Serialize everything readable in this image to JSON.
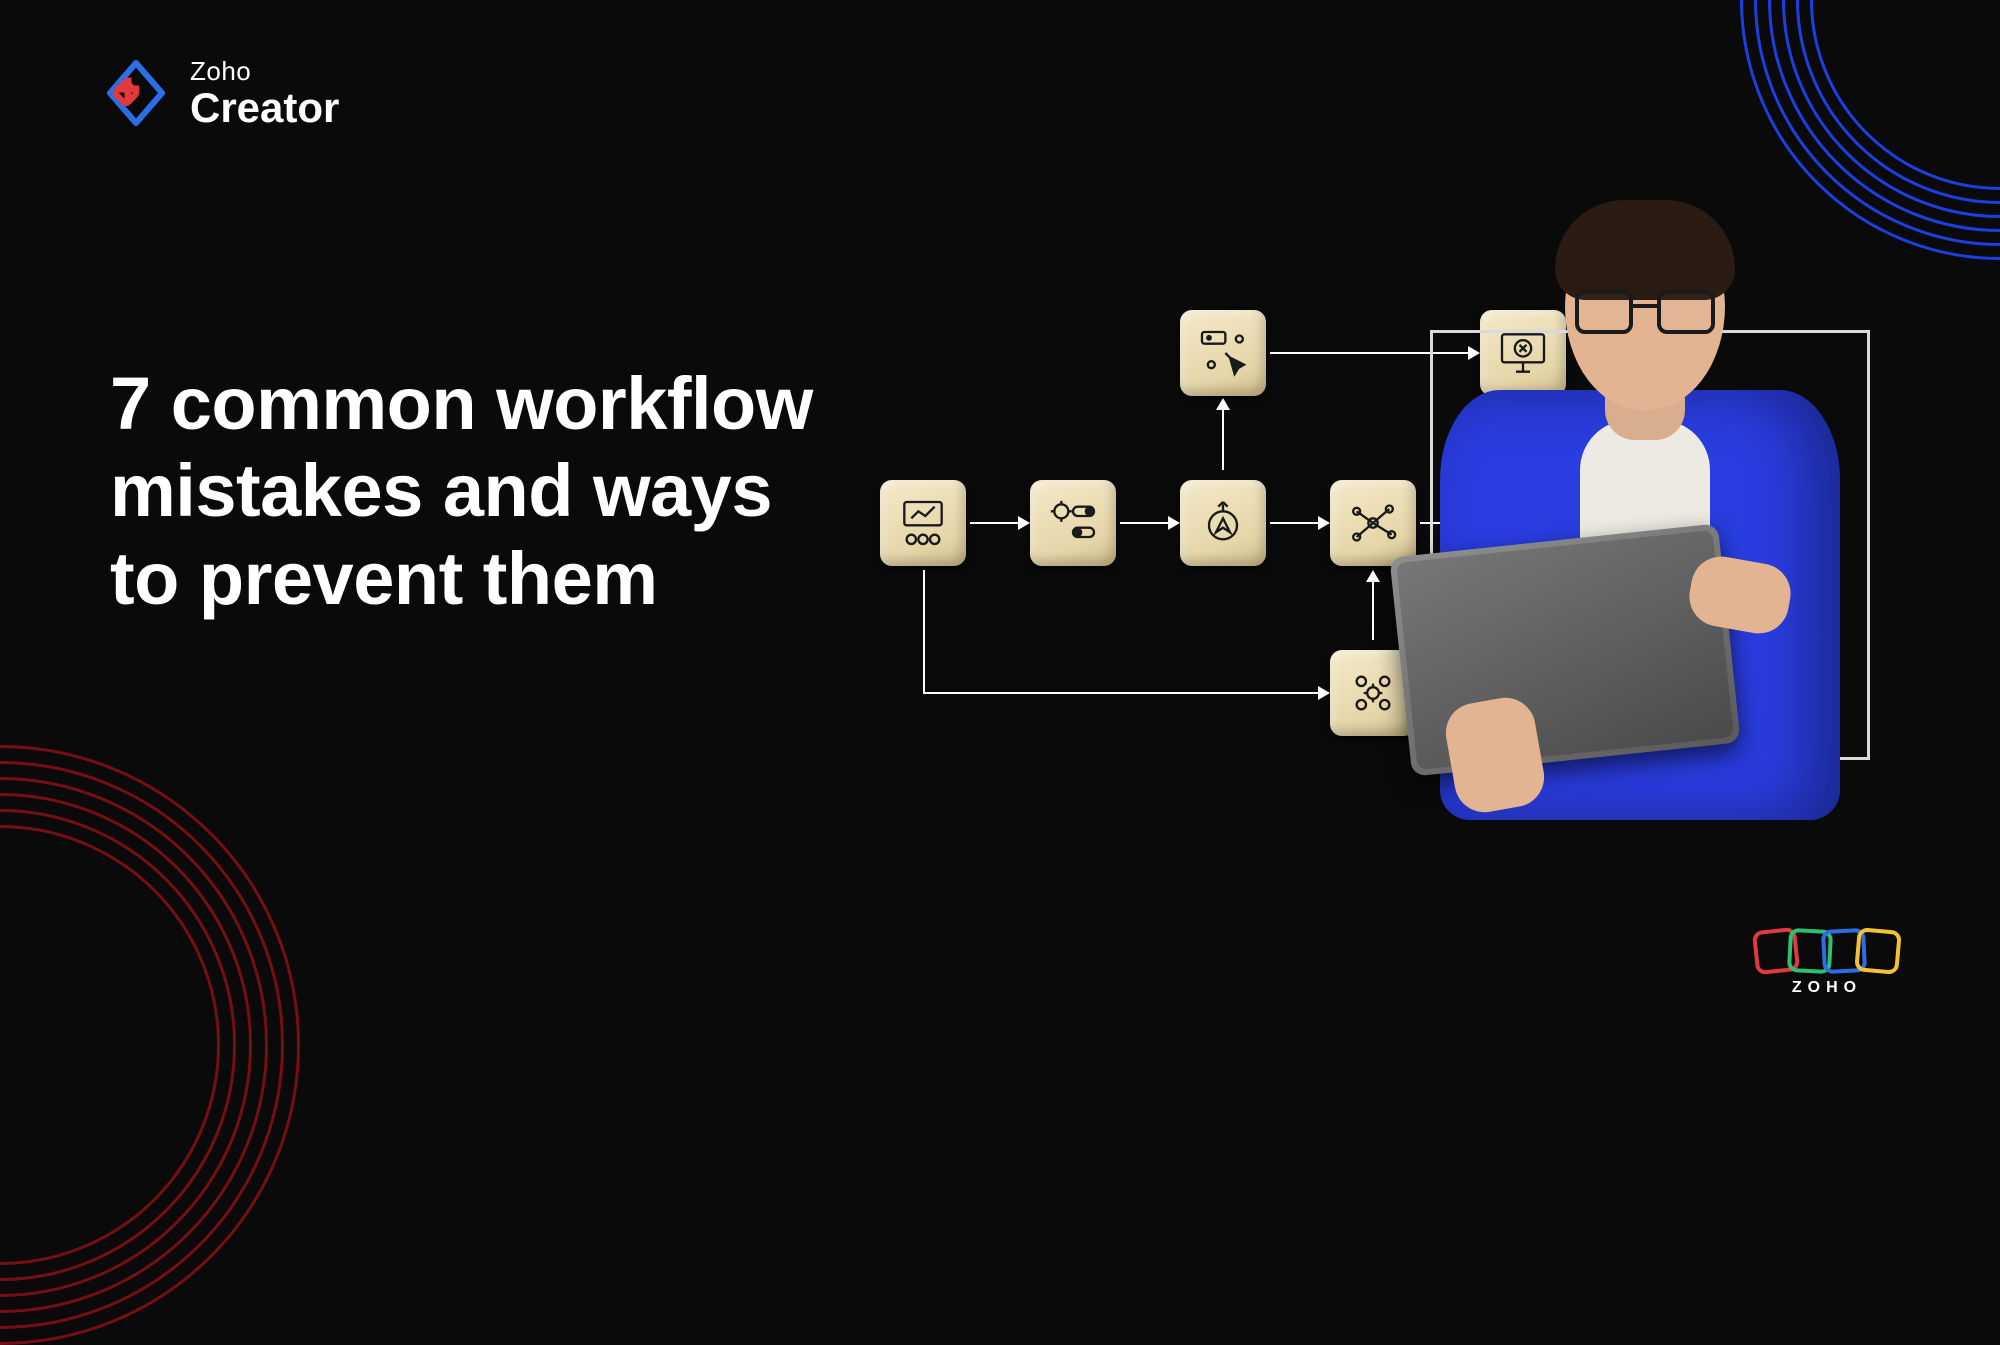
{
  "brand": {
    "line1": "Zoho",
    "line2": "Creator"
  },
  "headline": {
    "line1": "7 common workflow",
    "line2": "mistakes and ways",
    "line3": "to prevent them"
  },
  "diagram_tiles": {
    "t1": "presentation-team-icon",
    "t2": "gear-toggles-icon",
    "t3": "compass-gear-icon",
    "t4": "network-nodes-icon",
    "t5": "click-options-icon",
    "t6": "people-cycle-icon",
    "t7": "monitor-error-icon"
  },
  "footer": {
    "label": "ZOHO"
  },
  "colors": {
    "bg": "#0a0a0a",
    "accent_blue": "#1b3fe0",
    "accent_red": "#8a0f17",
    "shirt_blue": "#2a3de0",
    "tile": "#e5d6a8"
  }
}
